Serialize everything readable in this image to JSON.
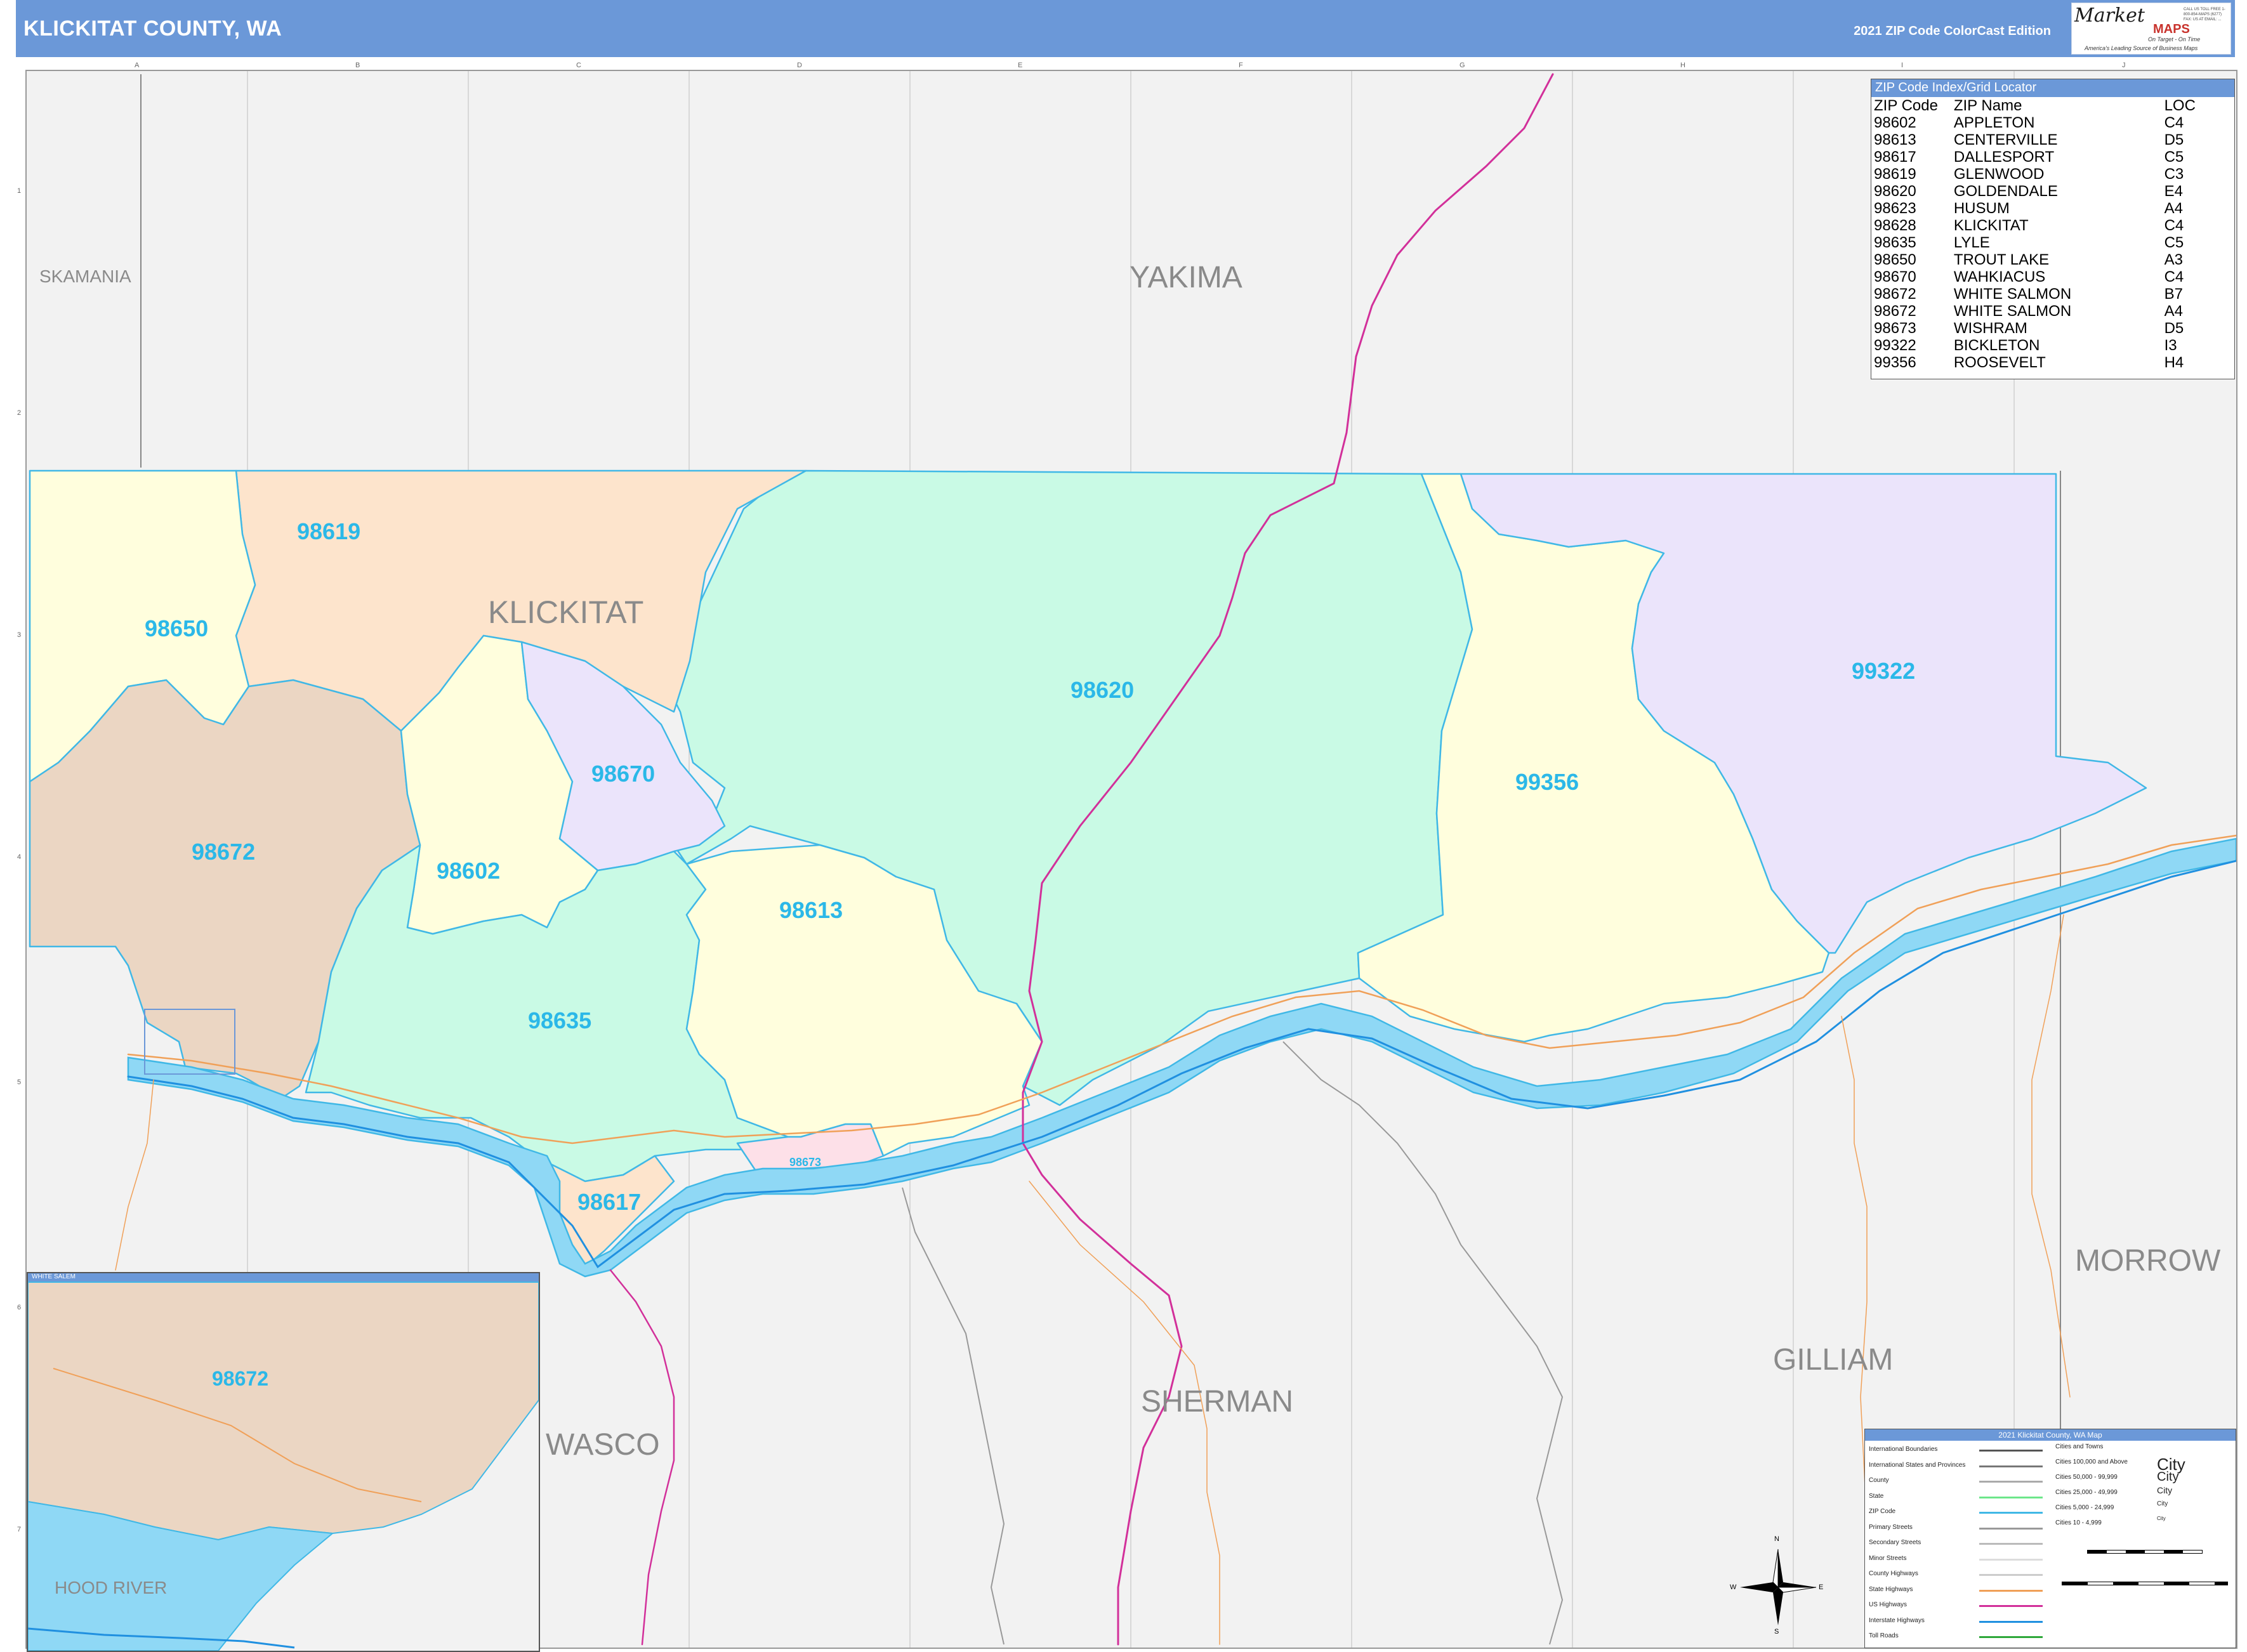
{
  "header": {
    "title": "KLICKITAT COUNTY, WA",
    "edition": "2021 ZIP Code ColorCast Edition",
    "logo": {
      "brand": "Market",
      "maps": "MAPS",
      "tagline": "On Target - On Time",
      "subtagline": "America's Leading Source of Business Maps",
      "contact": "CALL US TOLL FREE 1-800-854-MAPS (6277) FAX: US AT EMAIL: ..."
    }
  },
  "grid": {
    "columns": [
      "A",
      "B",
      "C",
      "D",
      "E",
      "F",
      "G",
      "H",
      "I",
      "J"
    ],
    "rows": [
      "1",
      "2",
      "3",
      "4",
      "5",
      "6",
      "7"
    ]
  },
  "map": {
    "county_labels": [
      "SKAMANIA",
      "YAKIMA",
      "KLICKITAT",
      "MORROW",
      "GILLIAM",
      "SHERMAN",
      "WASCO",
      "HOOD RIVER"
    ],
    "zip_labels": [
      "98619",
      "98650",
      "98670",
      "98602",
      "98672",
      "98620",
      "98613",
      "98635",
      "98617",
      "98673",
      "99356",
      "99322"
    ],
    "inset_zip_label": "98672",
    "inset_title": "WHITE SALEM",
    "colors": {
      "header": "#6b98d8",
      "zip_text": "#2bb8e8",
      "water": "#8fd8f5",
      "background": "#f2f2f2",
      "cream": "#fffedd",
      "peach": "#fde4cc",
      "tan": "#ebd6c3",
      "mint": "#c9fae5",
      "lavender": "#ebe4fb",
      "pink": "#fde0e8",
      "highway": "#d2309a"
    }
  },
  "zip_index": {
    "title": "ZIP Code Index/Grid Locator",
    "headers": [
      "ZIP Code",
      "ZIP Name",
      "LOC"
    ],
    "rows": [
      [
        "98602",
        "APPLETON",
        "C4"
      ],
      [
        "98613",
        "CENTERVILLE",
        "D5"
      ],
      [
        "98617",
        "DALLESPORT",
        "C5"
      ],
      [
        "98619",
        "GLENWOOD",
        "C3"
      ],
      [
        "98620",
        "GOLDENDALE",
        "E4"
      ],
      [
        "98623",
        "HUSUM",
        "A4"
      ],
      [
        "98628",
        "KLICKITAT",
        "C4"
      ],
      [
        "98635",
        "LYLE",
        "C5"
      ],
      [
        "98650",
        "TROUT LAKE",
        "A3"
      ],
      [
        "98670",
        "WAHKIACUS",
        "C4"
      ],
      [
        "98672",
        "WHITE SALMON",
        "B7"
      ],
      [
        "98672",
        "WHITE SALMON",
        "A4"
      ],
      [
        "98673",
        "WISHRAM",
        "D5"
      ],
      [
        "99322",
        "BICKLETON",
        "I3"
      ],
      [
        "99356",
        "ROOSEVELT",
        "H4"
      ]
    ]
  },
  "legend": {
    "title": "2021 Klickitat County, WA Map",
    "items": [
      "International Boundaries",
      "International States and Provinces",
      "County",
      "State",
      "ZIP Code",
      "Primary Streets",
      "Secondary Streets",
      "Minor Streets",
      "County Highways",
      "State Highways",
      "US Highways",
      "Interstate Highways",
      "Toll Roads"
    ],
    "cities_title": "Cities and Towns",
    "cities": [
      "Cities 100,000 and Above",
      "Cities 50,000 - 99,999",
      "Cities 25,000 - 49,999",
      "Cities 5,000 - 24,999",
      "Cities 10 - 4,999"
    ],
    "city_samples": [
      "City",
      "City",
      "City",
      "City",
      "City"
    ],
    "compass": [
      "N",
      "S",
      "E",
      "W"
    ]
  }
}
